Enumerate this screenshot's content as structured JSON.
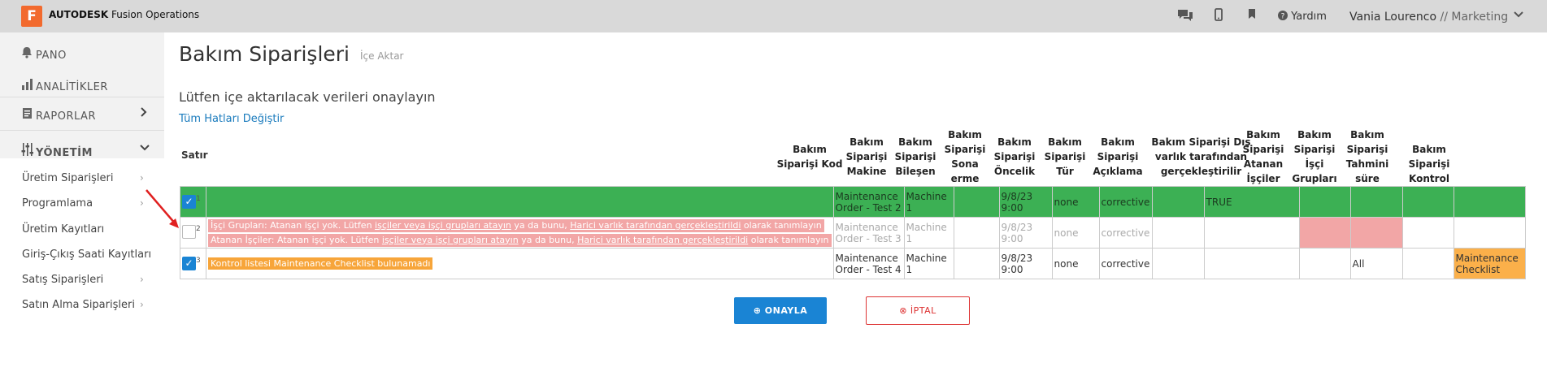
{
  "app": {
    "logo_letter": "F",
    "brand_bold": "AUTODESK",
    "brand_rest": " Fusion Operations"
  },
  "header": {
    "help": "Yardım",
    "user": "Vania Lourenco",
    "role": "// Marketing",
    "icons": [
      "chat-icon",
      "mobile-icon",
      "bookmark-icon",
      "help-icon",
      "chevron-down-icon"
    ]
  },
  "sidebar": {
    "pano": "PANO",
    "analitikler": "ANALİTİKLER",
    "raporlar": "RAPORLAR",
    "yonetim": "YÖNETİM",
    "items": [
      {
        "label": "Üretim Siparişleri",
        "arrow": true
      },
      {
        "label": "Programlama",
        "arrow": true
      },
      {
        "label": "Üretim Kayıtları",
        "arrow": false
      },
      {
        "label": "Giriş-Çıkış Saati Kayıtları",
        "arrow": false
      },
      {
        "label": "Satış Siparişleri",
        "arrow": true
      },
      {
        "label": "Satın Alma Siparişleri",
        "arrow": true
      }
    ]
  },
  "page": {
    "title": "Bakım Siparişleri",
    "subtitle": "İçe Aktar",
    "confirm_text": "Lütfen içe aktarılacak verileri onaylayın",
    "toggle_link": "Tüm Hatları Değiştir",
    "row_label": "Satır"
  },
  "columns": {
    "kod": "Bakım Siparişi Kod",
    "makine": "Bakım Siparişi Makine",
    "bilesen": "Bakım Siparişi Bileşen",
    "sona": "Bakım Siparişi Sona erme tarihi",
    "oncelik": "Bakım Siparişi Öncelik",
    "tur": "Bakım Siparişi Tür",
    "aciklama": "Bakım Siparişi Açıklama",
    "dis": "Bakım Siparişi Dış varlık tarafından gerçekleştirilir",
    "atanan": "Bakım Siparişi Atanan İşçiler",
    "grup": "Bakım Siparişi İşçi Grupları",
    "sure": "Bakım Siparişi Tahmini süre",
    "kontrol": "Bakım Siparişi Kontrol listesi"
  },
  "rows": [
    {
      "num": "1",
      "checked": true,
      "kod": "Maintenance Order - Test 2",
      "makine": "Machine 1",
      "bilesen": "",
      "sona": "9/8/23 9:00",
      "oncelik": "none",
      "tur": "corrective",
      "aciklama": "",
      "dis": "TRUE",
      "atanan": "",
      "grup": "",
      "sure": "",
      "kontrol": ""
    },
    {
      "num": "2",
      "checked": false,
      "err1_a": "İşçi Grupları: Atanan işçi yok. Lütfen ",
      "err1_link1": "işçiler veya işçi grupları atayın",
      "err1_b": " ya da bunu, ",
      "err1_link2": "Harici varlık tarafından gerçekleştirildi",
      "err1_c": " olarak tanımlayın",
      "err2_a": "Atanan İşçiler: Atanan işçi yok. Lütfen ",
      "err2_link1": "işçiler veya işçi grupları atayın",
      "err2_b": " ya da bunu, ",
      "err2_link2": "Harici varlık tarafından gerçekleştirildi",
      "err2_c": " olarak tanımlayın",
      "kod": "Maintenance Order - Test 3",
      "makine": "Machine 1",
      "bilesen": "",
      "sona": "9/8/23 9:00",
      "oncelik": "none",
      "tur": "corrective",
      "aciklama": "",
      "dis": "",
      "atanan": "",
      "grup": "",
      "sure": "",
      "kontrol": ""
    },
    {
      "num": "3",
      "checked": true,
      "warn": "Kontrol listesi Maintenance Checklist bulunamadı",
      "kod": "Maintenance Order - Test 4",
      "makine": "Machine 1",
      "bilesen": "",
      "sona": "9/8/23 9:00",
      "oncelik": "none",
      "tur": "corrective",
      "aciklama": "",
      "dis": "",
      "atanan": "",
      "grup": "All",
      "sure": "",
      "kontrol": "Maintenance Checklist"
    }
  ],
  "buttons": {
    "ok": "ONAYLA",
    "cancel": "İPTAL"
  },
  "colors": {
    "green_row": "#3cb054",
    "error": "#f2a6a6",
    "warning": "#f7a53a",
    "primary": "#1a84d4",
    "cancel": "#dd3333"
  }
}
